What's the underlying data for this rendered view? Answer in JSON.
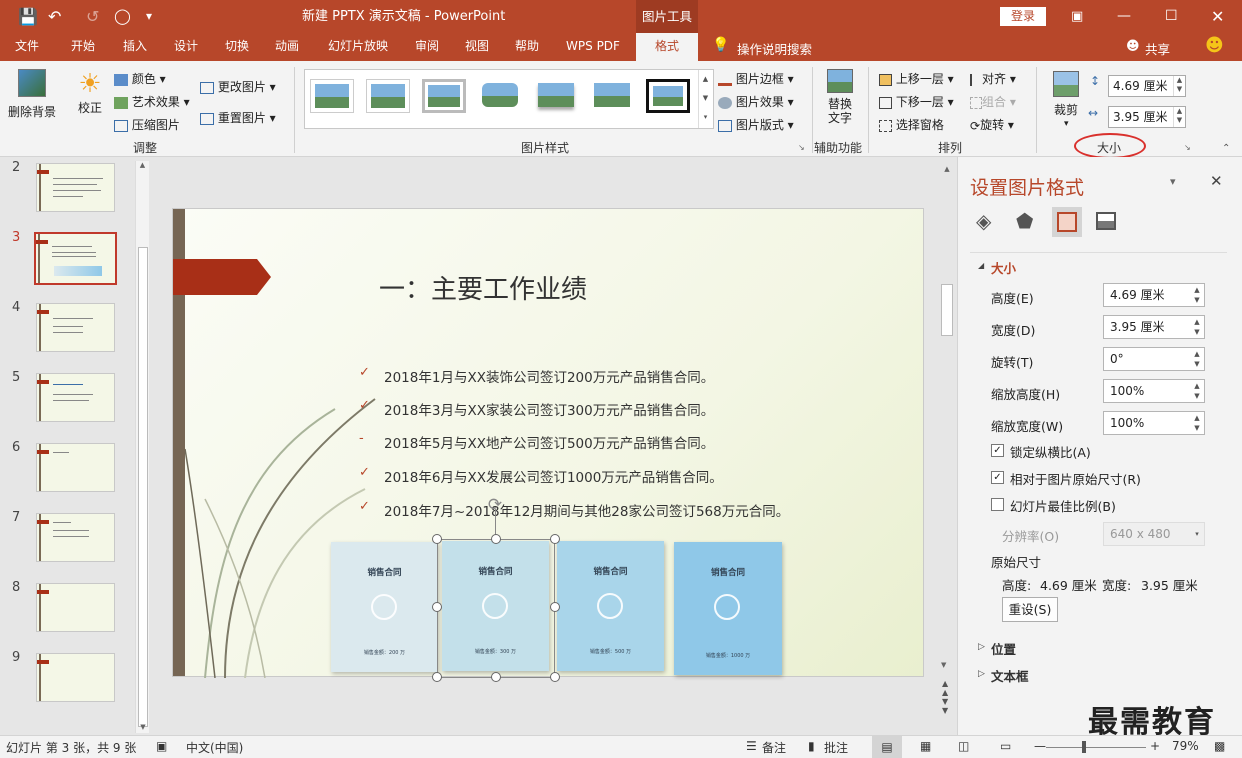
{
  "title_bar": {
    "document_title": "新建 PPTX 演示文稿 - PowerPoint",
    "context_tab": "图片工具",
    "login_label": "登录"
  },
  "menu_tabs": [
    "文件",
    "开始",
    "插入",
    "设计",
    "切换",
    "动画",
    "幻灯片放映",
    "审阅",
    "视图",
    "帮助",
    "WPS PDF",
    "格式"
  ],
  "active_tab": "格式",
  "tell_me": "操作说明搜索",
  "share": "共享",
  "ribbon": {
    "remove_bg": "删除背景",
    "correct": "校正",
    "color": "颜色",
    "art_effect": "艺术效果",
    "compress": "压缩图片",
    "change_pic": "更改图片",
    "reset_pic": "重置图片",
    "group_adjust": "调整",
    "pic_border": "图片边框",
    "pic_effect": "图片效果",
    "pic_layout": "图片版式",
    "group_styles": "图片样式",
    "alt_text_1": "替换",
    "alt_text_2": "文字",
    "group_access": "辅助功能",
    "bring_forward": "上移一层",
    "send_backward": "下移一层",
    "selection_pane": "选择窗格",
    "align": "对齐",
    "group": "组合",
    "rotate": "旋转",
    "group_arrange": "排列",
    "crop": "裁剪",
    "height_value": "4.69 厘米",
    "width_value": "3.95 厘米",
    "group_size": "大小"
  },
  "slides_panel": {
    "numbers": [
      "2",
      "3",
      "4",
      "5",
      "6",
      "7",
      "8",
      "9"
    ],
    "active": "3"
  },
  "slide": {
    "title": "一：主要工作业绩",
    "bullets": [
      {
        "mark": "✓",
        "text": "2018年1月与XX装饰公司签订200万元产品销售合同。"
      },
      {
        "mark": "✓",
        "text": "2018年3月与XX家装公司签订300万元产品销售合同。"
      },
      {
        "mark": "-",
        "text": "2018年5月与XX地产公司签订500万元产品销售合同。"
      },
      {
        "mark": "✓",
        "text": "2018年6月与XX发展公司签订1000万元产品销售合同。"
      },
      {
        "mark": "✓",
        "text": "2018年7月~2018年12月期间与其他28家公司签订568万元合同。"
      }
    ],
    "docs": [
      {
        "title": "销售合同",
        "amount": "销售金额：200 万",
        "color": "#dbe9ee"
      },
      {
        "title": "销售合同",
        "amount": "销售金额：300 万",
        "color": "#c3e0ea"
      },
      {
        "title": "销售合同",
        "amount": "销售金额：500 万",
        "color": "#a9d5ea"
      },
      {
        "title": "销售合同",
        "amount": "销售金额：1000 万",
        "color": "#8fc8e8"
      }
    ]
  },
  "format_pane": {
    "title": "设置图片格式",
    "section_size": "大小",
    "height_label": "高度(E)",
    "height_value": "4.69 厘米",
    "width_label": "宽度(D)",
    "width_value": "3.95 厘米",
    "rotate_label": "旋转(T)",
    "rotate_value": "0°",
    "scale_h_label": "缩放高度(H)",
    "scale_h_value": "100%",
    "scale_w_label": "缩放宽度(W)",
    "scale_w_value": "100%",
    "lock_ratio": "锁定纵横比(A)",
    "relative_original": "相对于图片原始尺寸(R)",
    "best_scale": "幻灯片最佳比例(B)",
    "resolution_label": "分辨率(O)",
    "resolution_value": "640 x 480",
    "original_size": "原始尺寸",
    "orig_height_label": "高度:",
    "orig_height": "4.69 厘米",
    "orig_width_label": "宽度:",
    "orig_width": "3.95 厘米",
    "reset": "重设(S)",
    "section_position": "位置",
    "section_textbox": "文本框"
  },
  "status_bar": {
    "slide_info": "幻灯片 第 3 张，共 9 张",
    "language": "中文(中国)",
    "notes": "备注",
    "comments": "批注",
    "zoom": "79%"
  },
  "watermark": "最需教育",
  "colors": {
    "accent": "#b7472a",
    "selected_ring": "#d9302c"
  }
}
